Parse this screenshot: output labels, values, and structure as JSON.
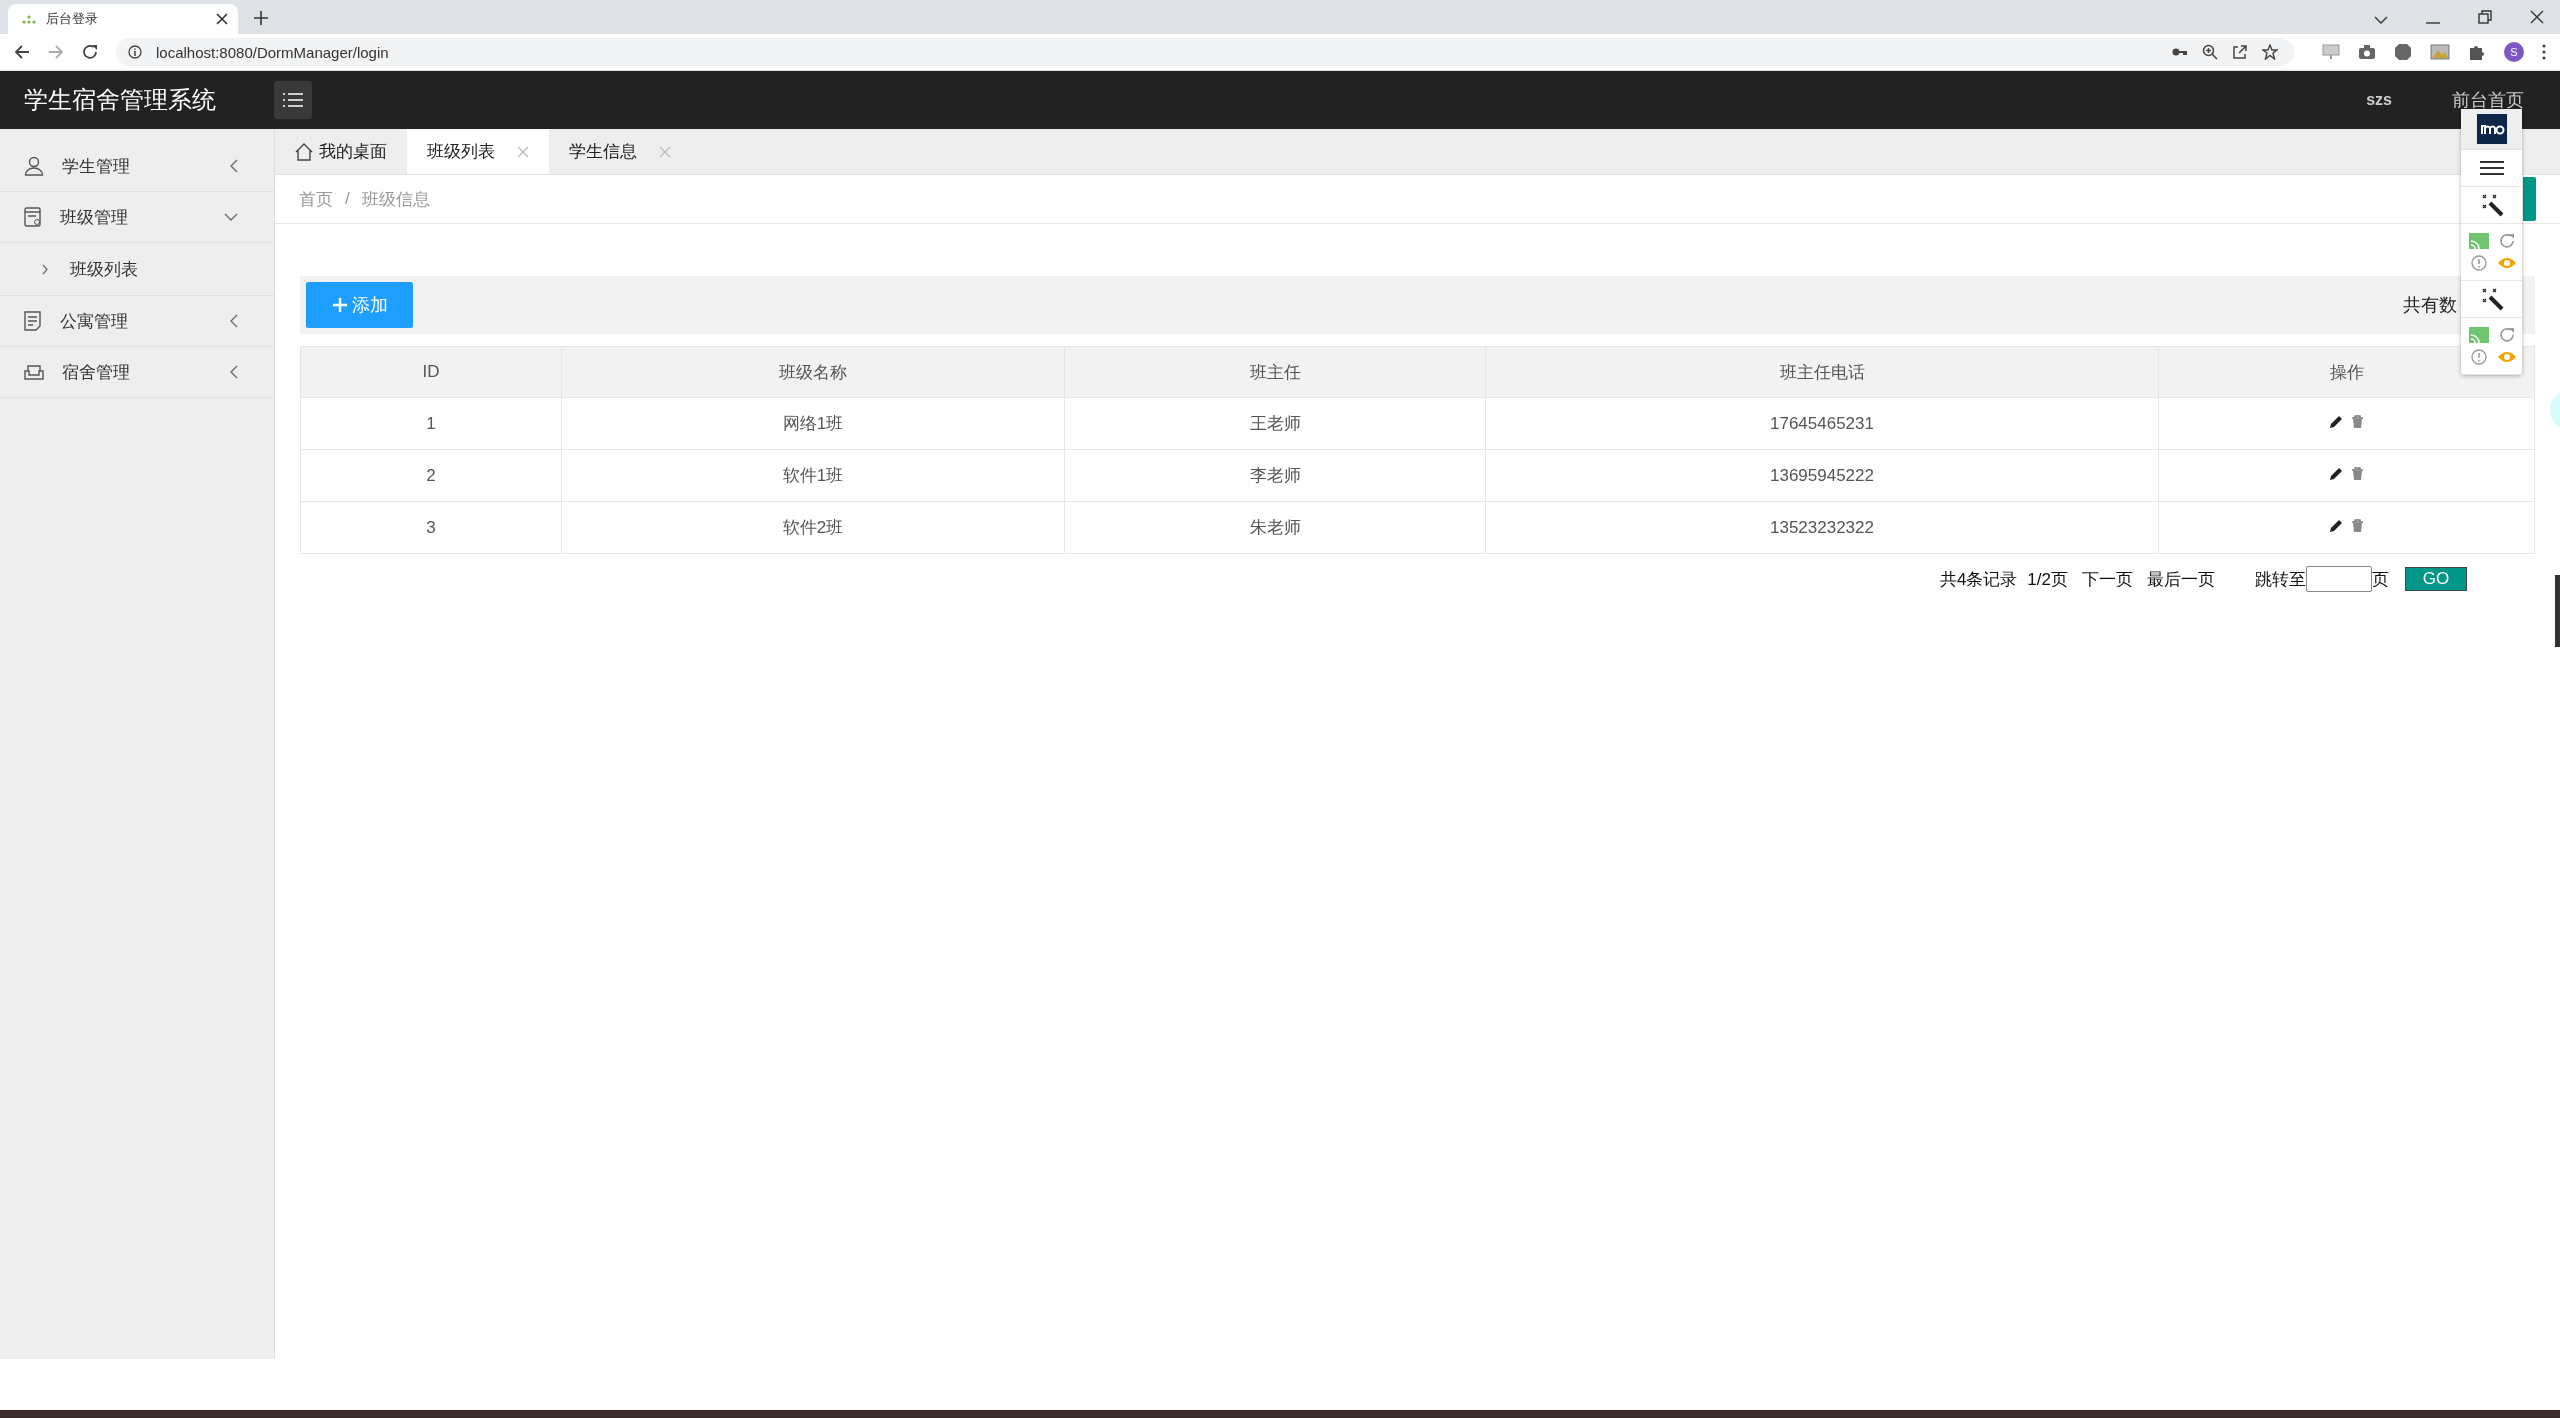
{
  "browser": {
    "tab_title": "后台登录",
    "url": "localhost:8080/DormManager/login",
    "avatar_letter": "S"
  },
  "header": {
    "title": "学生宿舍管理系统",
    "user": "szs",
    "front_link": "前台首页"
  },
  "sidebar": {
    "items": [
      {
        "label": "学生管理",
        "expanded": false
      },
      {
        "label": "班级管理",
        "expanded": true,
        "children": [
          {
            "label": "班级列表"
          }
        ]
      },
      {
        "label": "公寓管理",
        "expanded": false
      },
      {
        "label": "宿舍管理",
        "expanded": false
      }
    ]
  },
  "tabs": [
    {
      "label": "我的桌面",
      "kind": "home",
      "selected": false
    },
    {
      "label": "班级列表",
      "kind": "closable",
      "selected": true
    },
    {
      "label": "学生信息",
      "kind": "closable",
      "selected": false
    }
  ],
  "breadcrumb": [
    "首页",
    "班级信息"
  ],
  "breadcrumb_separator": "/",
  "toolbar": {
    "add_button": "添加",
    "count_text": "共有数"
  },
  "table": {
    "columns": [
      "ID",
      "班级名称",
      "班主任",
      "班主任电话",
      "操作"
    ],
    "rows": [
      [
        "1",
        "网络1班",
        "王老师",
        "17645465231"
      ],
      [
        "2",
        "软件1班",
        "李老师",
        "13695945222"
      ],
      [
        "3",
        "软件2班",
        "朱老师",
        "13523232322"
      ]
    ]
  },
  "pagination": {
    "total": "共4条记录",
    "page": "1/2页",
    "next": "下一页",
    "last": "最后一页",
    "jump_label": "跳转至",
    "page_unit": "页",
    "go": "GO"
  }
}
